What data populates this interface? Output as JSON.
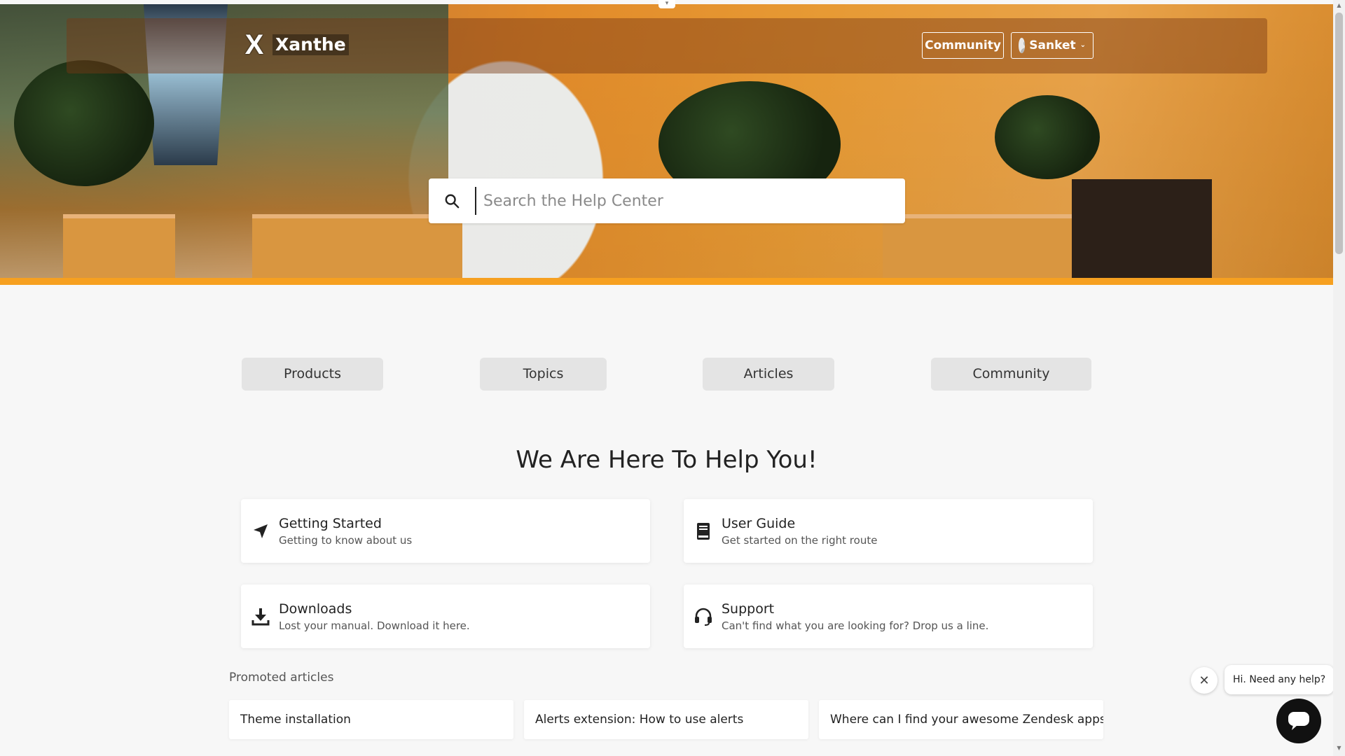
{
  "header": {
    "brand": "Xanthe",
    "logo_mark": "X",
    "community_label": "Community",
    "user_name": "Sanket",
    "accent": "#f6a020"
  },
  "search": {
    "placeholder": "Search the Help Center",
    "icon": "search-icon"
  },
  "nav": {
    "items": [
      "Products",
      "Topics",
      "Articles",
      "Community"
    ]
  },
  "main": {
    "heading": "We Are Here To Help You!",
    "cards": [
      {
        "title": "Getting Started",
        "subtitle": "Getting to know about us",
        "icon": "navigation-arrow-icon"
      },
      {
        "title": "User Guide",
        "subtitle": "Get started on the right route",
        "icon": "book-icon"
      },
      {
        "title": "Downloads",
        "subtitle": "Lost your manual. Download it here.",
        "icon": "download-icon"
      },
      {
        "title": "Support",
        "subtitle": "Can't find what you are looking for? Drop us a line.",
        "icon": "headset-icon"
      }
    ]
  },
  "promoted": {
    "title": "Promoted articles",
    "articles": [
      "Theme installation",
      "Alerts extension: How to use alerts",
      "Where can I find your awesome Zendesk apps?"
    ]
  },
  "chat": {
    "greeting": "Hi. Need any help?",
    "close_icon": "close-icon",
    "launcher_icon": "chat-bubble-icon"
  }
}
